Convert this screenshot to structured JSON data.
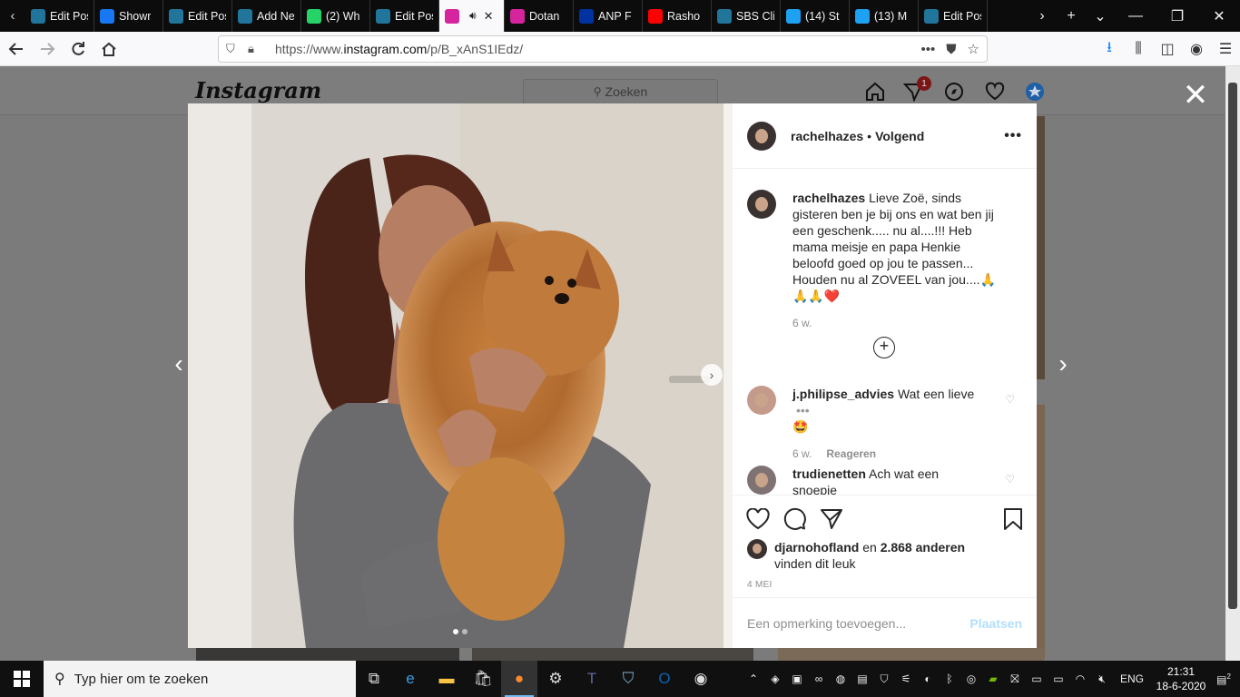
{
  "browser": {
    "tabs": [
      {
        "label": "Edit Post ‹",
        "icon": "wordpress-icon",
        "color": "#21759b"
      },
      {
        "label": "Showr",
        "icon": "facebook-icon",
        "color": "#1877f2"
      },
      {
        "label": "Edit Post ‹",
        "icon": "wordpress-icon",
        "color": "#21759b"
      },
      {
        "label": "Add New F",
        "icon": "wordpress-icon",
        "color": "#21759b"
      },
      {
        "label": "(2) Wh",
        "icon": "whatsapp-icon",
        "color": "#25d366"
      },
      {
        "label": "Edit Post ‹",
        "icon": "wordpress-icon",
        "color": "#21759b"
      },
      {
        "label": "",
        "icon": "instagram-icon",
        "color": "#d6249f",
        "active": true
      },
      {
        "label": "Dotan",
        "icon": "instagram-icon",
        "color": "#d6249f"
      },
      {
        "label": "ANP F",
        "icon": "anp-icon",
        "color": "#0033a0"
      },
      {
        "label": "Rasho",
        "icon": "youtube-icon",
        "color": "#ff0000"
      },
      {
        "label": "SBS Clips ‹",
        "icon": "wordpress-icon",
        "color": "#21759b"
      },
      {
        "label": "(14) St",
        "icon": "twitter-icon",
        "color": "#1da1f2"
      },
      {
        "label": "(13) M",
        "icon": "twitter-icon",
        "color": "#1da1f2"
      },
      {
        "label": "Edit Post ‹",
        "icon": "wordpress-icon",
        "color": "#21759b"
      }
    ],
    "url_prefix": "https://www.",
    "url_domain": "instagram.com",
    "url_path": "/p/B_xAnS1IEdz/"
  },
  "instagram": {
    "logo": "Instagram",
    "search_placeholder": "Zoeken",
    "notification_count": "1"
  },
  "post": {
    "author": "rachelhazes",
    "follow_status": "Volgend",
    "more": "•••",
    "caption": "Lieve Zoë, sinds gisteren ben je bij ons en wat ben jij een geschenk..... nu al....!!! Heb mama meisje en papa Henkie beloofd goed op jou te passen... Houden nu al ZOVEEL van jou....🙏🙏🙏❤️",
    "caption_age": "6 w.",
    "comments": [
      {
        "user": "j.philipse_advies",
        "text": "Wat een lieve",
        "emoji": "🤩",
        "age": "6 w.",
        "reply": "Reageren",
        "more": "•••"
      },
      {
        "user": "trudienetten",
        "text": "Ach wat een snoepie",
        "emoji": "🤩"
      }
    ],
    "likes_user": "djarnohofland",
    "likes_mid": " en ",
    "likes_count": "2.868 anderen",
    "likes_suffix": "vinden dit leuk",
    "date": "4 MEI",
    "comment_placeholder": "Een opmerking toevoegen...",
    "post_button": "Plaatsen",
    "image_slide": 1,
    "image_slides_total": 2
  },
  "taskbar": {
    "search_placeholder": "Typ hier om te zoeken",
    "language": "ENG",
    "time": "21:31",
    "date": "18-6-2020",
    "notification_badge": "2"
  }
}
